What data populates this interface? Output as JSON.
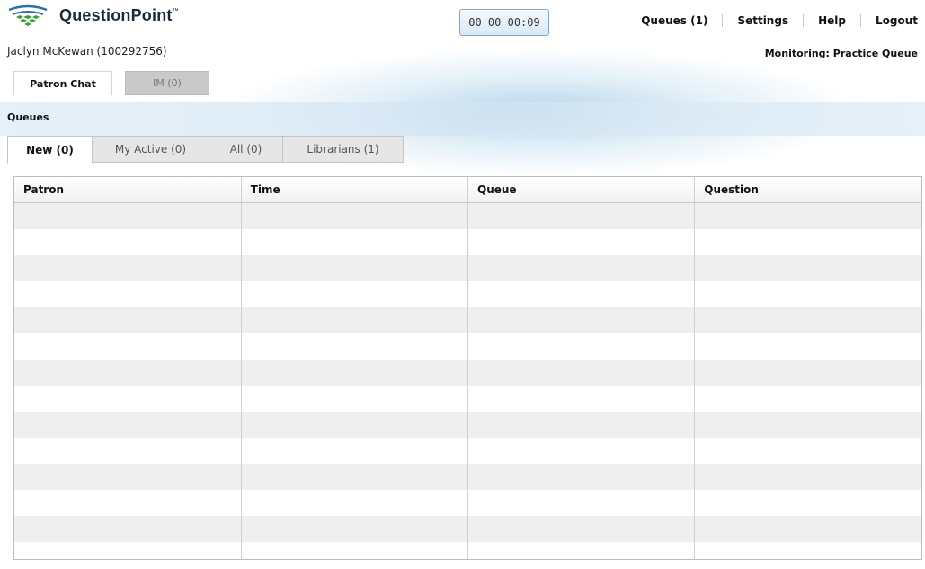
{
  "app": {
    "name": "QuestionPoint",
    "trademark": "™"
  },
  "timer": "00 00 00:09",
  "nav": {
    "queues": "Queues (1)",
    "settings": "Settings",
    "help": "Help",
    "logout": "Logout"
  },
  "user": "Jaclyn McKewan (100292756)",
  "monitoring": "Monitoring: Practice Queue",
  "main_tabs": [
    {
      "label": "Patron Chat",
      "active": true
    },
    {
      "label": "IM (0)",
      "active": false
    }
  ],
  "queues_title": "Queues",
  "sub_tabs": [
    {
      "label": "New (0)",
      "active": true
    },
    {
      "label": "My Active (0)",
      "active": false
    },
    {
      "label": "All (0)",
      "active": false
    },
    {
      "label": "Librarians (1)",
      "active": false
    }
  ],
  "table": {
    "columns": [
      "Patron",
      "Time",
      "Queue",
      "Question"
    ],
    "rows": []
  },
  "colors": {
    "accent": "#a9c9e2",
    "logo_green": "#3f9b3a",
    "logo_blue": "#2f6fa8"
  },
  "icons": {
    "logo": "questionpoint-logo-icon"
  }
}
